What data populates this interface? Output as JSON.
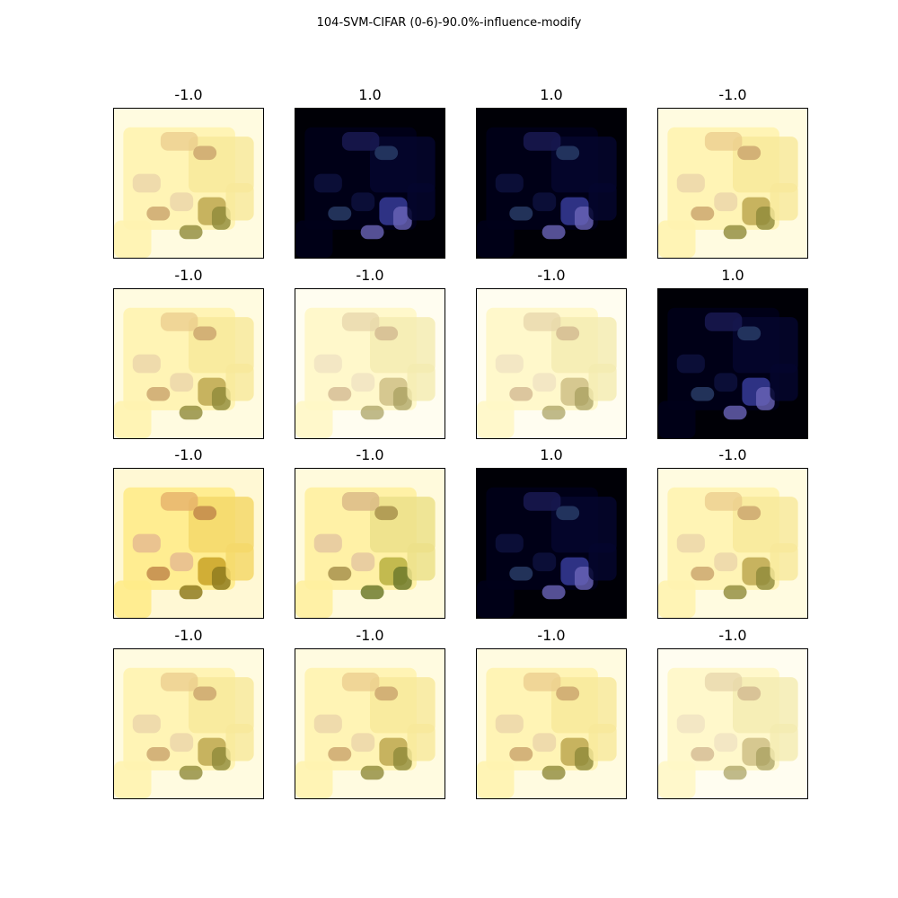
{
  "figure": {
    "title": "104-SVM-CIFAR (0-6)-90.0%-influence-modify"
  },
  "grid": {
    "rows": 4,
    "cols": 4,
    "panels": [
      {
        "label": "-1.0",
        "variant": "light"
      },
      {
        "label": "1.0",
        "variant": "dark"
      },
      {
        "label": "1.0",
        "variant": "dark"
      },
      {
        "label": "-1.0",
        "variant": "light"
      },
      {
        "label": "-1.0",
        "variant": "light"
      },
      {
        "label": "-1.0",
        "variant": "light-pale"
      },
      {
        "label": "-1.0",
        "variant": "light-pale"
      },
      {
        "label": "1.0",
        "variant": "dark"
      },
      {
        "label": "-1.0",
        "variant": "light-strong"
      },
      {
        "label": "-1.0",
        "variant": "light-strong-green"
      },
      {
        "label": "1.0",
        "variant": "dark"
      },
      {
        "label": "-1.0",
        "variant": "light"
      },
      {
        "label": "-1.0",
        "variant": "light"
      },
      {
        "label": "-1.0",
        "variant": "light"
      },
      {
        "label": "-1.0",
        "variant": "light"
      },
      {
        "label": "-1.0",
        "variant": "light-pale"
      }
    ]
  },
  "colors": {
    "light_bg": "#fffbe0",
    "dark_bg": "#000008",
    "frame": "#000000"
  }
}
